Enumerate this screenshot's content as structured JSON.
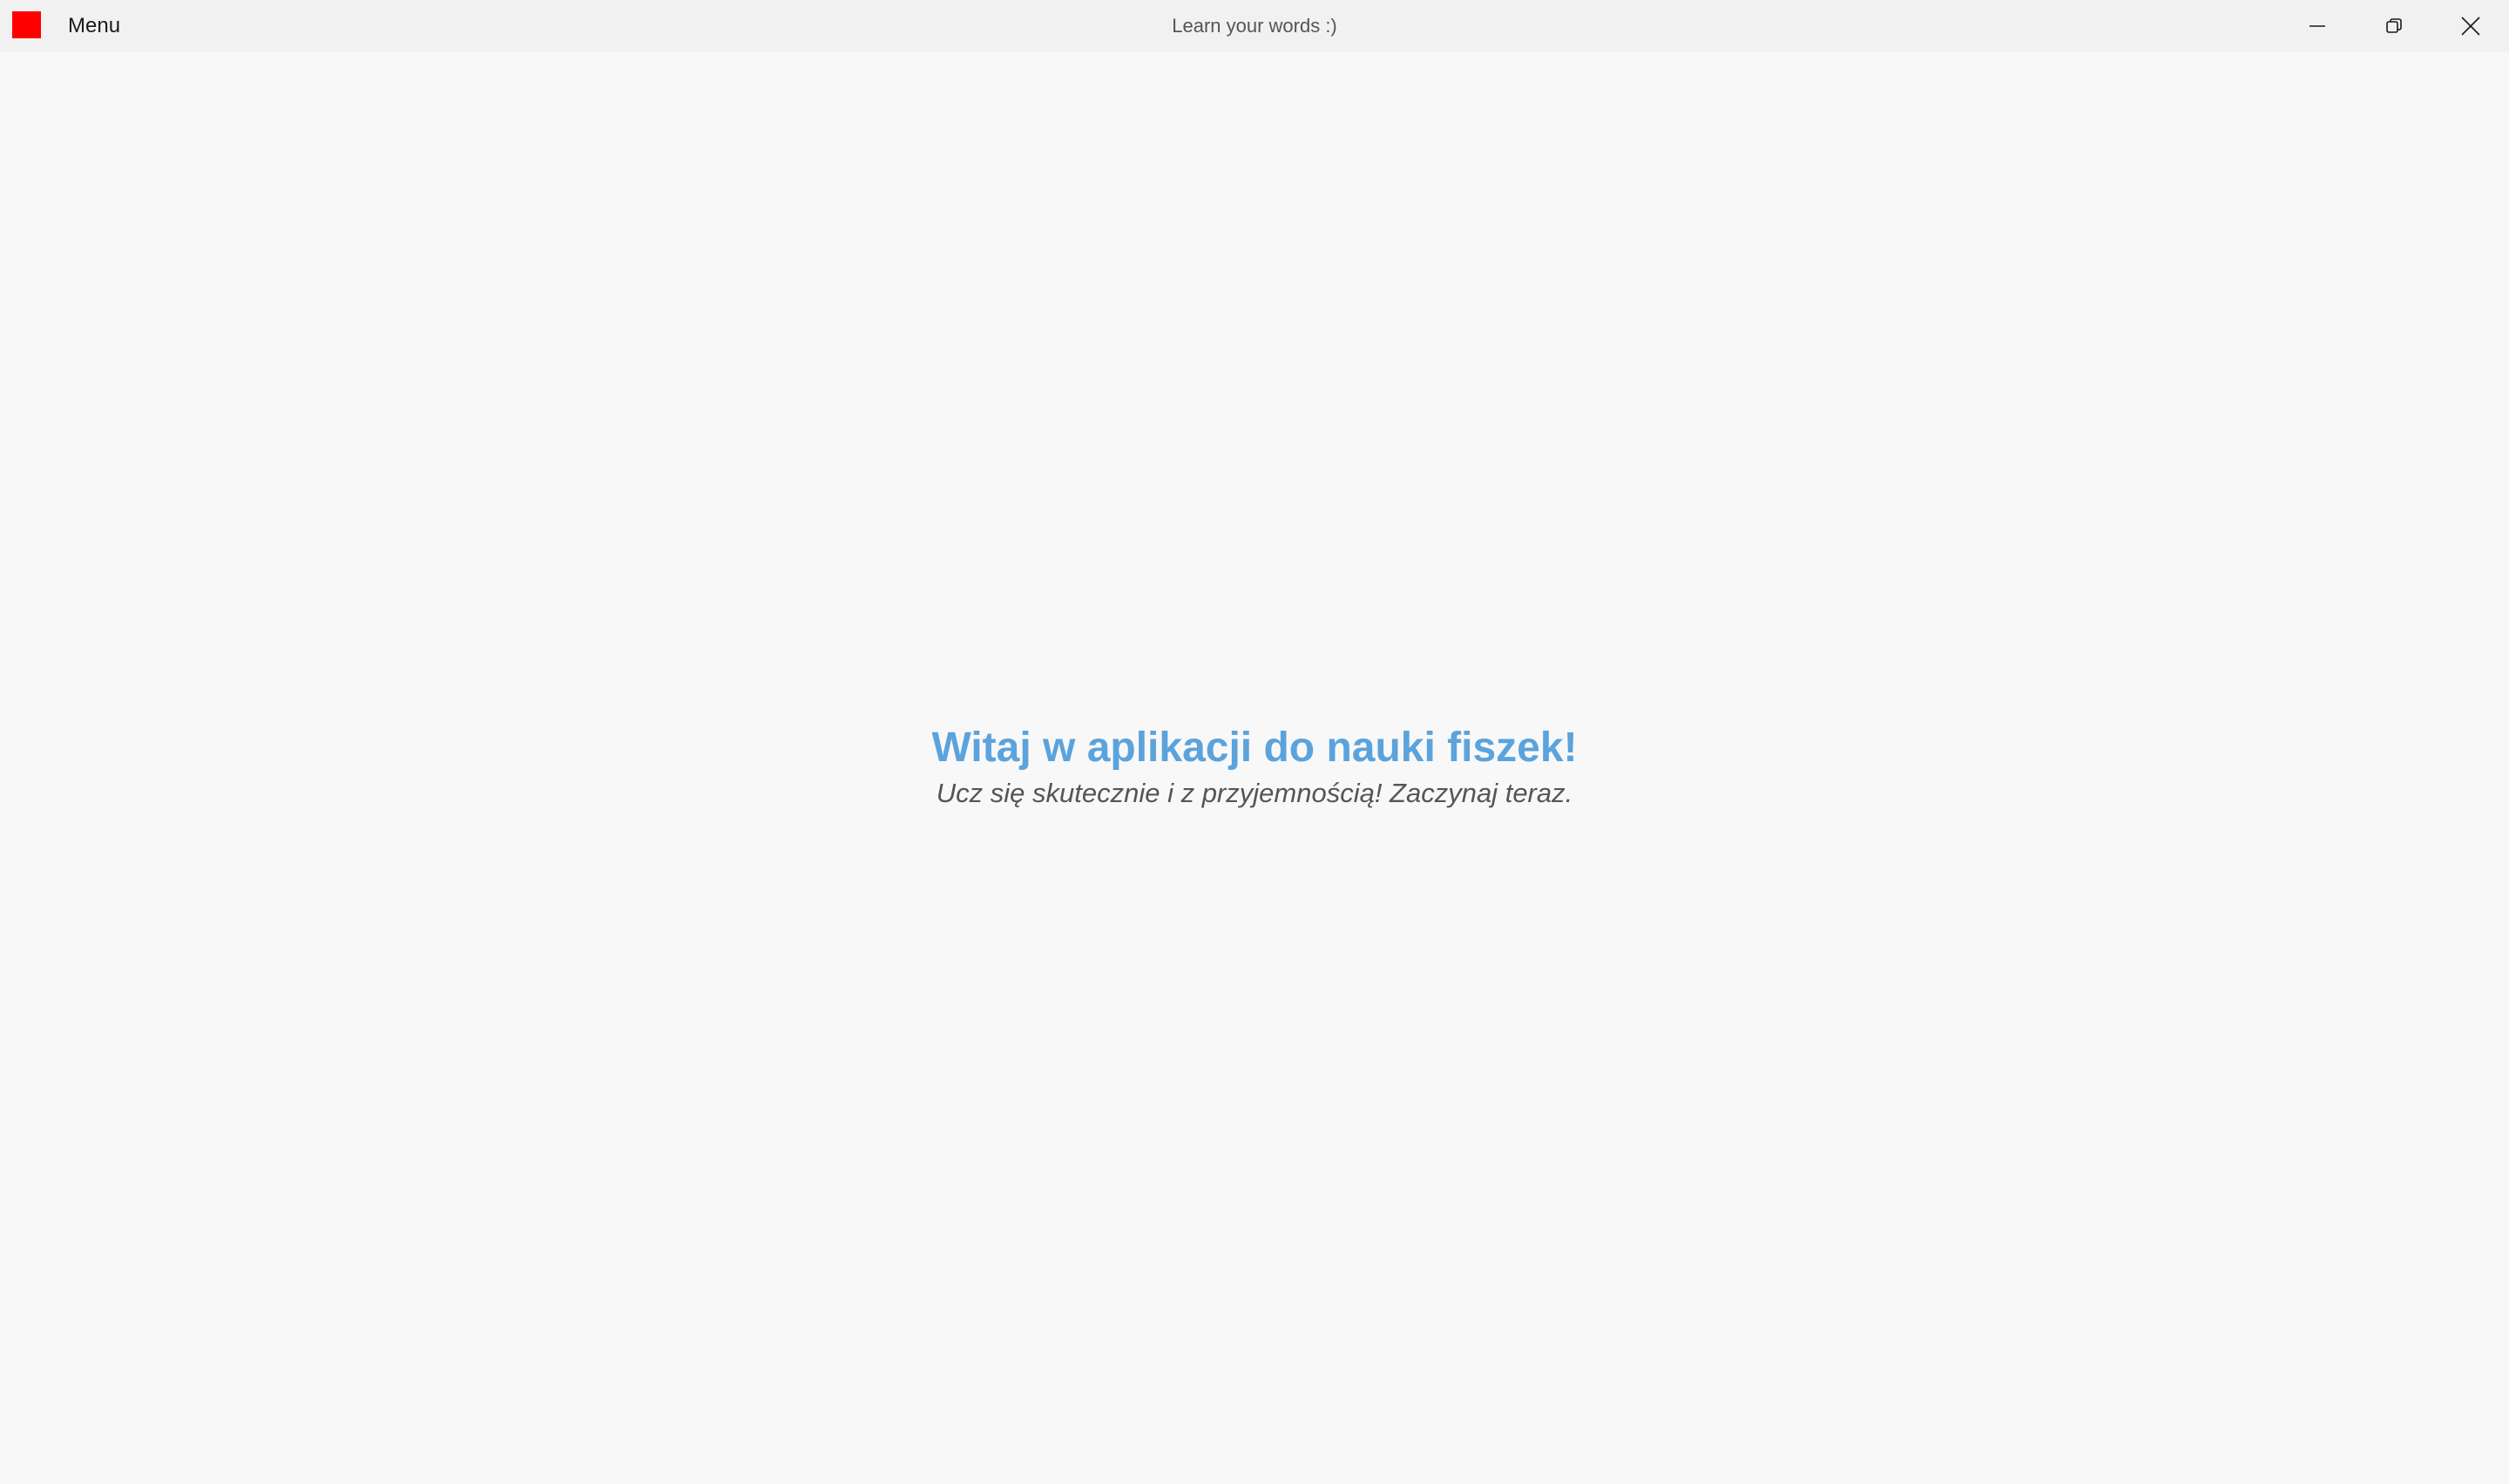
{
  "window": {
    "title": "Learn your words :)",
    "menu_label": "Menu",
    "logo_color": "#ff0000",
    "caption_buttons": [
      "minimize-icon",
      "restore-icon",
      "close-icon"
    ]
  },
  "main": {
    "welcome_title": "Witaj w aplikacji do nauki fiszek!",
    "welcome_subtitle": "Ucz się skutecznie i z przyjemnością! Zaczynaj teraz.",
    "title_color": "#5ba3dc"
  }
}
